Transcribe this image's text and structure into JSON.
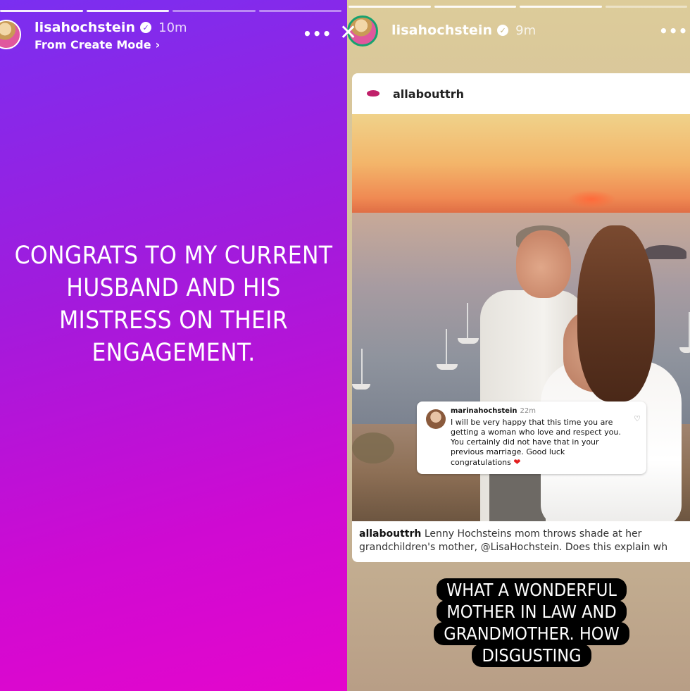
{
  "left_story": {
    "username": "lisahochstein",
    "verified_glyph": "✓",
    "time": "10m",
    "subtitle": "From Create Mode",
    "subtitle_chevron": "›",
    "more_glyph": "•••",
    "close_glyph": "✕",
    "text": "CONGRATS TO MY CURRENT\nHUSBAND AND HIS\nMISTRESS ON THEIR\nENGAGEMENT.",
    "progress_segments": 4,
    "progress_done": 2,
    "gradient_colors": [
      "#7a2ff0",
      "#e406cc"
    ]
  },
  "right_story": {
    "username": "lisahochstein",
    "verified_glyph": "✓",
    "time": "9m",
    "more_glyph": "•••",
    "progress_segments": 4,
    "progress_done": 3,
    "post": {
      "account": "allabouttrh",
      "comment": {
        "username": "marinahochstein",
        "time": "22m",
        "text": "I will be very happy that this time you are\ngetting a woman who love and respect you.\nYou certainly did not have that in your\nprevious marriage. Good luck\ncongratulations",
        "heart_glyph": "❤",
        "like_glyph": "♡"
      },
      "caption_user": "allabouttrh",
      "caption_line1": "Lenny Hochsteins mom throws shade at her",
      "caption_line2": "grandchildren's mother, @LisaHochstein. Does this explain wh"
    },
    "overlay_lines": [
      "WHAT A WONDERFUL",
      "MOTHER IN LAW AND",
      "GRANDMOTHER. HOW",
      "DISGUSTING"
    ]
  }
}
